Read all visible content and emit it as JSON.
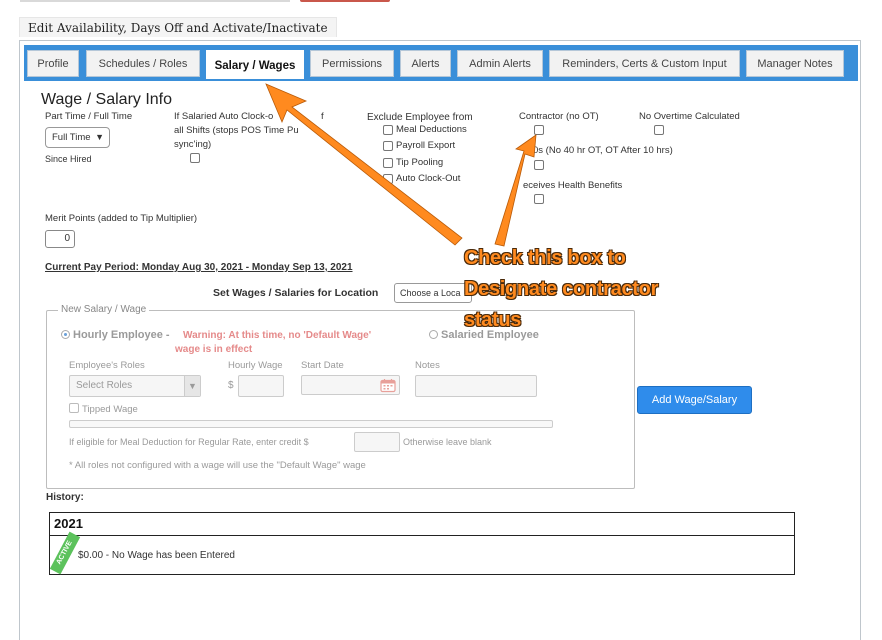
{
  "edit_tab": "Edit Availability, Days Off and Activate/Inactivate",
  "tabs": [
    {
      "label": "Profile"
    },
    {
      "label": "Schedules / Roles"
    },
    {
      "label": "Salary / Wages"
    },
    {
      "label": "Permissions"
    },
    {
      "label": "Alerts"
    },
    {
      "label": "Admin Alerts"
    },
    {
      "label": "Reminders, Certs & Custom Input"
    },
    {
      "label": "Manager Notes"
    }
  ],
  "section_title": "Wage / Salary Info",
  "part_time": {
    "label": "Part Time / Full Time",
    "value": "Full Time",
    "since_hired": "Since Hired"
  },
  "salaried_clockout": {
    "line1": "If Salaried Auto Clock-o",
    "line1b": "f",
    "line2": "all Shifts (stops POS Time Pu",
    "line3": "sync'ing)"
  },
  "exclude": {
    "title": "Exclude Employee from",
    "items": [
      "Meal Deductions",
      "Payroll Export",
      "Tip Pooling",
      "Auto Clock-Out"
    ]
  },
  "contractor": {
    "label": "Contractor (no OT)",
    "hours_rule": "0s (No 40 hr OT, OT After 10 hrs)",
    "health": "eceives Health Benefits"
  },
  "no_overtime": {
    "label": "No Overtime Calculated"
  },
  "merit": {
    "label": "Merit Points (added to Tip Multiplier)",
    "value": "0"
  },
  "pay_period": "Current Pay Period: Monday Aug 30, 2021 - Monday Sep 13, 2021",
  "location": {
    "label": "Set Wages / Salaries for Location",
    "placeholder": "Choose a Loca"
  },
  "new_wage": {
    "legend": "New Salary / Wage",
    "hourly": "Hourly Employee -",
    "warning_line1": "Warning: At this time, no 'Default Wage'",
    "warning_line2": "wage is in effect",
    "salaried": "Salaried Employee",
    "roles_label": "Employee's Roles",
    "roles_value": "Select Roles",
    "hourly_wage_label": "Hourly Wage",
    "currency": "$",
    "start_date_label": "Start Date",
    "notes_label": "Notes",
    "tipped": "Tipped Wage",
    "meal_credit_pre": "If eligible for Meal Deduction for Regular Rate, enter credit $",
    "meal_credit_post": "Otherwise leave blank",
    "footnote": "* All roles not configured with a wage will use the \"Default Wage\" wage"
  },
  "add_button": "Add Wage/Salary",
  "history": {
    "label": "History:",
    "year": "2021",
    "badge": "ACTIVE",
    "row": "$0.00 - No Wage has been Entered"
  },
  "callout": {
    "line1": "Check this box to",
    "line2": "Designate contractor",
    "line3": "status"
  },
  "colors": {
    "tabbar": "#3a8fd9",
    "button": "#2f8ceb",
    "callout": "#ff8a1f",
    "active_badge": "#5cc25c",
    "warning": "#e58a8a"
  }
}
